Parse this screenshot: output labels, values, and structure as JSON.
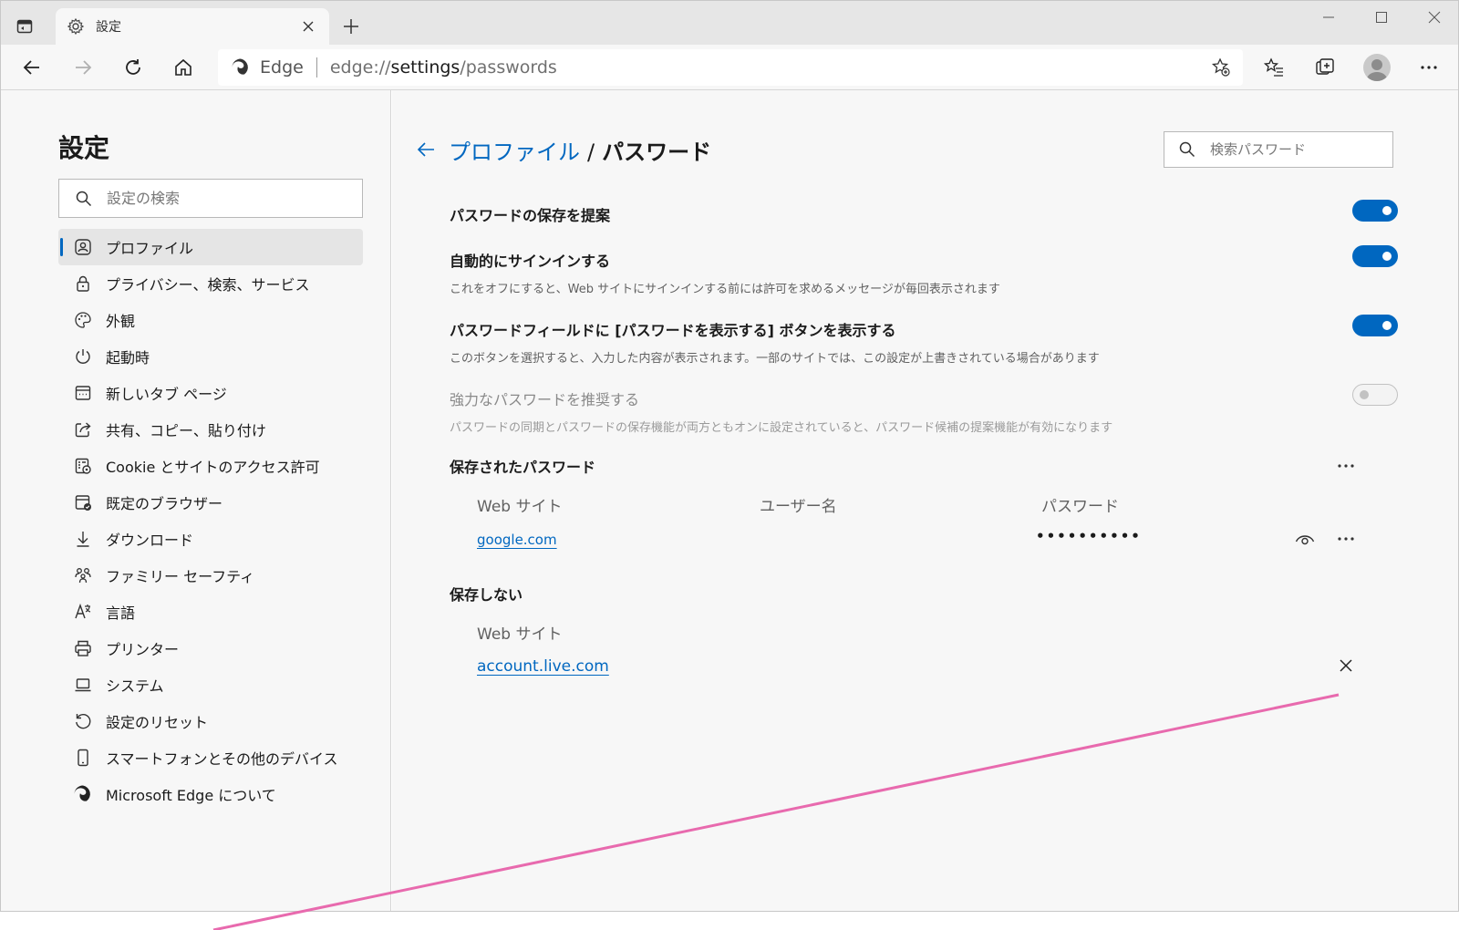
{
  "tab": {
    "title": "設定"
  },
  "address": {
    "brand": "Edge",
    "url_prefix": "edge://",
    "url_host": "settings",
    "url_path": "/passwords"
  },
  "sidebar": {
    "title": "設定",
    "search_placeholder": "設定の検索",
    "items": [
      {
        "label": "プロファイル",
        "icon": "profile-icon",
        "active": true
      },
      {
        "label": "プライバシー、検索、サービス",
        "icon": "lock-icon"
      },
      {
        "label": "外観",
        "icon": "palette-icon"
      },
      {
        "label": "起動時",
        "icon": "power-icon"
      },
      {
        "label": "新しいタブ ページ",
        "icon": "new-tab-page-icon"
      },
      {
        "label": "共有、コピー、貼り付け",
        "icon": "share-icon"
      },
      {
        "label": "Cookie とサイトのアクセス許可",
        "icon": "site-permissions-icon"
      },
      {
        "label": "既定のブラウザー",
        "icon": "default-browser-icon"
      },
      {
        "label": "ダウンロード",
        "icon": "download-icon"
      },
      {
        "label": "ファミリー セーフティ",
        "icon": "family-icon"
      },
      {
        "label": "言語",
        "icon": "language-icon"
      },
      {
        "label": "プリンター",
        "icon": "printer-icon"
      },
      {
        "label": "システム",
        "icon": "laptop-icon"
      },
      {
        "label": "設定のリセット",
        "icon": "reset-icon"
      },
      {
        "label": "スマートフォンとその他のデバイス",
        "icon": "phone-icon"
      },
      {
        "label": "Microsoft Edge について",
        "icon": "edge-logo-icon"
      }
    ]
  },
  "main": {
    "breadcrumb_parent": "プロファイル",
    "breadcrumb_sep": "/",
    "breadcrumb_current": "パスワード",
    "search_placeholder": "検索パスワード",
    "settings": [
      {
        "title": "パスワードの保存を提案",
        "desc": "",
        "on": true
      },
      {
        "title": "自動的にサインインする",
        "desc": "これをオフにすると、Web サイトにサインインする前には許可を求めるメッセージが毎回表示されます",
        "on": true
      },
      {
        "title": "パスワードフィールドに [パスワードを表示する] ボタンを表示する",
        "desc": "このボタンを選択すると、入力した内容が表示されます。一部のサイトでは、この設定が上書きされている場合があります",
        "on": true
      },
      {
        "title": "強力なパスワードを推奨する",
        "desc": "パスワードの同期とパスワードの保存機能が両方ともオンに設定されていると、パスワード候補の提案機能が有効になります",
        "on": false,
        "disabled": true
      }
    ],
    "saved": {
      "title": "保存されたパスワード",
      "col_site": "Web サイト",
      "col_user": "ユーザー名",
      "col_password": "パスワード",
      "rows": [
        {
          "site": "google.com",
          "user": "",
          "password": "••••••••••"
        }
      ]
    },
    "never_saved": {
      "title": "保存しない",
      "col_site": "Web サイト",
      "rows": [
        {
          "site": "account.live.com"
        }
      ]
    }
  },
  "colors": {
    "accent": "#0067c0",
    "annotation_line": "#e86aae"
  }
}
